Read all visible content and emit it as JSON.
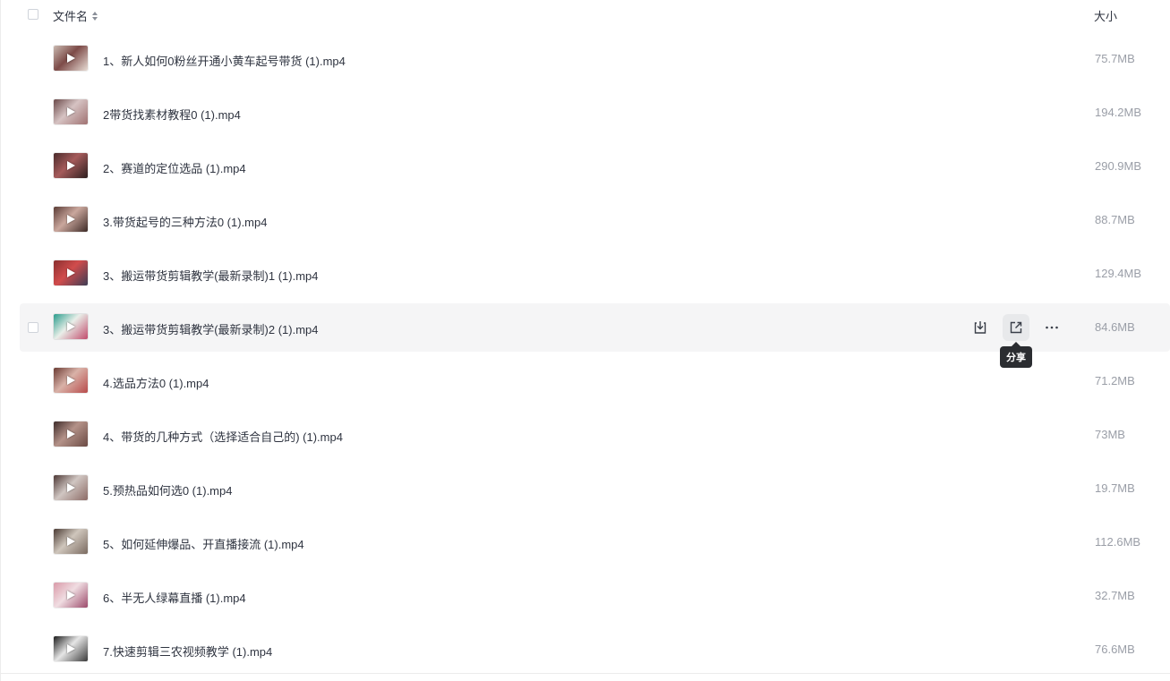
{
  "header": {
    "name_label": "文件名",
    "size_label": "大小"
  },
  "files": [
    {
      "name": "1、新人如何0粉丝开通小黄车起号带货 (1).mp4",
      "size": "75.7MB",
      "thumb_colors": [
        "#c9b9b0",
        "#7d4b48",
        "#e8ddd6"
      ]
    },
    {
      "name": "2带货找素材教程0 (1).mp4",
      "size": "194.2MB",
      "thumb_colors": [
        "#6b4a4a",
        "#d6c3c3",
        "#a07272"
      ]
    },
    {
      "name": "2、赛道的定位选品 (1).mp4",
      "size": "290.9MB",
      "thumb_colors": [
        "#4a2b2b",
        "#a55b5b",
        "#2d1f1f"
      ]
    },
    {
      "name": "3.带货起号的三种方法0 (1).mp4",
      "size": "88.7MB",
      "thumb_colors": [
        "#5b3c36",
        "#caa79d",
        "#3d2a26"
      ]
    },
    {
      "name": "3、搬运带货剪辑教学(最新录制)1 (1).mp4",
      "size": "129.4MB",
      "thumb_colors": [
        "#8a2f2f",
        "#d14c4c",
        "#3d3d55"
      ]
    },
    {
      "name": "3、搬运带货剪辑教学(最新录制)2 (1).mp4",
      "size": "84.6MB",
      "thumb_colors": [
        "#2a9c8c",
        "#e9efe9",
        "#c14b6c"
      ]
    },
    {
      "name": "4.选品方法0 (1).mp4",
      "size": "71.2MB",
      "thumb_colors": [
        "#6b3b33",
        "#d9b2a8",
        "#b84b4b"
      ]
    },
    {
      "name": "4、带货的几种方式（选择适合自己的) (1).mp4",
      "size": "73MB",
      "thumb_colors": [
        "#3e2c2a",
        "#b49289",
        "#6b4a44"
      ]
    },
    {
      "name": "5.预热品如何选0 (1).mp4",
      "size": "19.7MB",
      "thumb_colors": [
        "#4d3835",
        "#d0c6c2",
        "#8c6b66"
      ]
    },
    {
      "name": "5、如何延伸爆品、开直播接流 (1).mp4",
      "size": "112.6MB",
      "thumb_colors": [
        "#4a3a33",
        "#cfc6bc",
        "#7a6a60"
      ]
    },
    {
      "name": "6、半无人绿幕直播 (1).mp4",
      "size": "32.7MB",
      "thumb_colors": [
        "#d99aa8",
        "#f0dde2",
        "#9c4b6b"
      ]
    },
    {
      "name": "7.快速剪辑三农视频教学 (1).mp4",
      "size": "76.6MB",
      "thumb_colors": [
        "#1c1c1c",
        "#e6e6e6",
        "#3a3a3a"
      ]
    }
  ],
  "hovered_row_index": 5,
  "row_actions": {
    "download": "download-icon",
    "share": "share-icon",
    "more": "more-icon"
  },
  "tooltip": {
    "text": "分享"
  }
}
